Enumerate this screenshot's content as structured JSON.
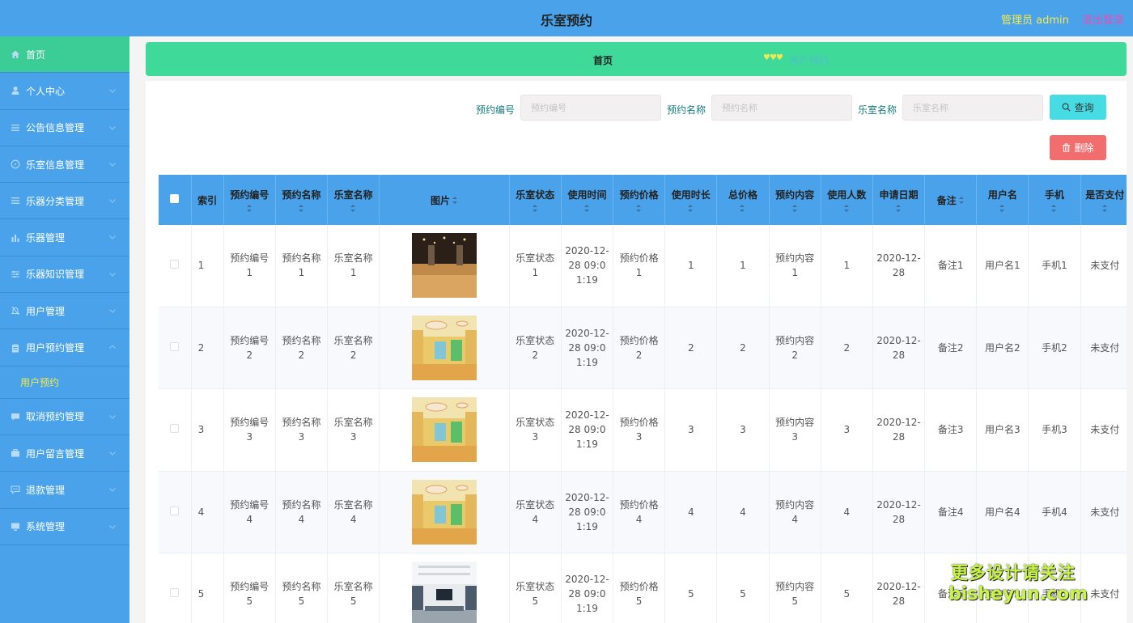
{
  "header": {
    "title": "乐室预约",
    "admin": "管理员 admin",
    "logout": "退出登录"
  },
  "sidebar": {
    "items": [
      {
        "label": "首页",
        "icon": "home-icon"
      },
      {
        "label": "个人中心",
        "icon": "person-icon"
      },
      {
        "label": "公告信息管理",
        "icon": "list-icon"
      },
      {
        "label": "乐室信息管理",
        "icon": "compass-icon"
      },
      {
        "label": "乐器分类管理",
        "icon": "list-icon"
      },
      {
        "label": "乐器管理",
        "icon": "bar-chart-icon"
      },
      {
        "label": "乐器知识管理",
        "icon": "sliders-icon"
      },
      {
        "label": "用户管理",
        "icon": "bell-icon"
      },
      {
        "label": "用户预约管理",
        "icon": "clipboard-icon"
      }
    ],
    "sub_item": "用户预约",
    "items_after": [
      {
        "label": "取消预约管理",
        "icon": "chat-icon"
      },
      {
        "label": "用户留言管理",
        "icon": "briefcase-icon"
      },
      {
        "label": "退款管理",
        "icon": "message-icon"
      },
      {
        "label": "系统管理",
        "icon": "monitor-icon"
      }
    ]
  },
  "breadcrumb": {
    "home": "首页",
    "hearts": "♥♥♥",
    "current": "用户预约"
  },
  "search": {
    "field1_label": "预约编号",
    "field1_placeholder": "预约编号",
    "field2_label": "预约名称",
    "field2_placeholder": "预约名称",
    "field3_label": "乐室名称",
    "field3_placeholder": "乐室名称",
    "query_label": "查询",
    "delete_label": "删除"
  },
  "table": {
    "columns": [
      "索引",
      "预约编号",
      "预约名称",
      "乐室名称",
      "图片",
      "乐室状态",
      "使用时间",
      "预约价格",
      "使用时长",
      "总价格",
      "预约内容",
      "使用人数",
      "申请日期",
      "备注",
      "用户名",
      "手机",
      "是否支付"
    ],
    "rows": [
      {
        "index": "1",
        "no": "预约编号1",
        "name": "预约名称1",
        "room": "乐室名称1",
        "status": "乐室状态1",
        "time": "2020-12-28 09:01:19",
        "price": "预约价格1",
        "duration": "1",
        "total": "1",
        "content": "预约内容1",
        "people": "1",
        "date": "2020-12-28",
        "note": "备注1",
        "user": "用户名1",
        "phone": "手机1",
        "paid": "未支付"
      },
      {
        "index": "2",
        "no": "预约编号2",
        "name": "预约名称2",
        "room": "乐室名称2",
        "status": "乐室状态2",
        "time": "2020-12-28 09:01:19",
        "price": "预约价格2",
        "duration": "2",
        "total": "2",
        "content": "预约内容2",
        "people": "2",
        "date": "2020-12-28",
        "note": "备注2",
        "user": "用户名2",
        "phone": "手机2",
        "paid": "未支付"
      },
      {
        "index": "3",
        "no": "预约编号3",
        "name": "预约名称3",
        "room": "乐室名称3",
        "status": "乐室状态3",
        "time": "2020-12-28 09:01:19",
        "price": "预约价格3",
        "duration": "3",
        "total": "3",
        "content": "预约内容3",
        "people": "3",
        "date": "2020-12-28",
        "note": "备注3",
        "user": "用户名3",
        "phone": "手机3",
        "paid": "未支付"
      },
      {
        "index": "4",
        "no": "预约编号4",
        "name": "预约名称4",
        "room": "乐室名称4",
        "status": "乐室状态4",
        "time": "2020-12-28 09:01:19",
        "price": "预约价格4",
        "duration": "4",
        "total": "4",
        "content": "预约内容4",
        "people": "4",
        "date": "2020-12-28",
        "note": "备注4",
        "user": "用户名4",
        "phone": "手机4",
        "paid": "未支付"
      },
      {
        "index": "5",
        "no": "预约编号5",
        "name": "预约名称5",
        "room": "乐室名称5",
        "status": "乐室状态5",
        "time": "2020-12-28 09:01:19",
        "price": "预约价格5",
        "duration": "5",
        "total": "5",
        "content": "预约内容5",
        "people": "5",
        "date": "2020-12-28",
        "note": "备注5",
        "user": "用户名5",
        "phone": "手机5",
        "paid": "未支付"
      }
    ]
  },
  "watermark": {
    "line1": "更多设计请关注",
    "line2": "bisheyun.com"
  }
}
